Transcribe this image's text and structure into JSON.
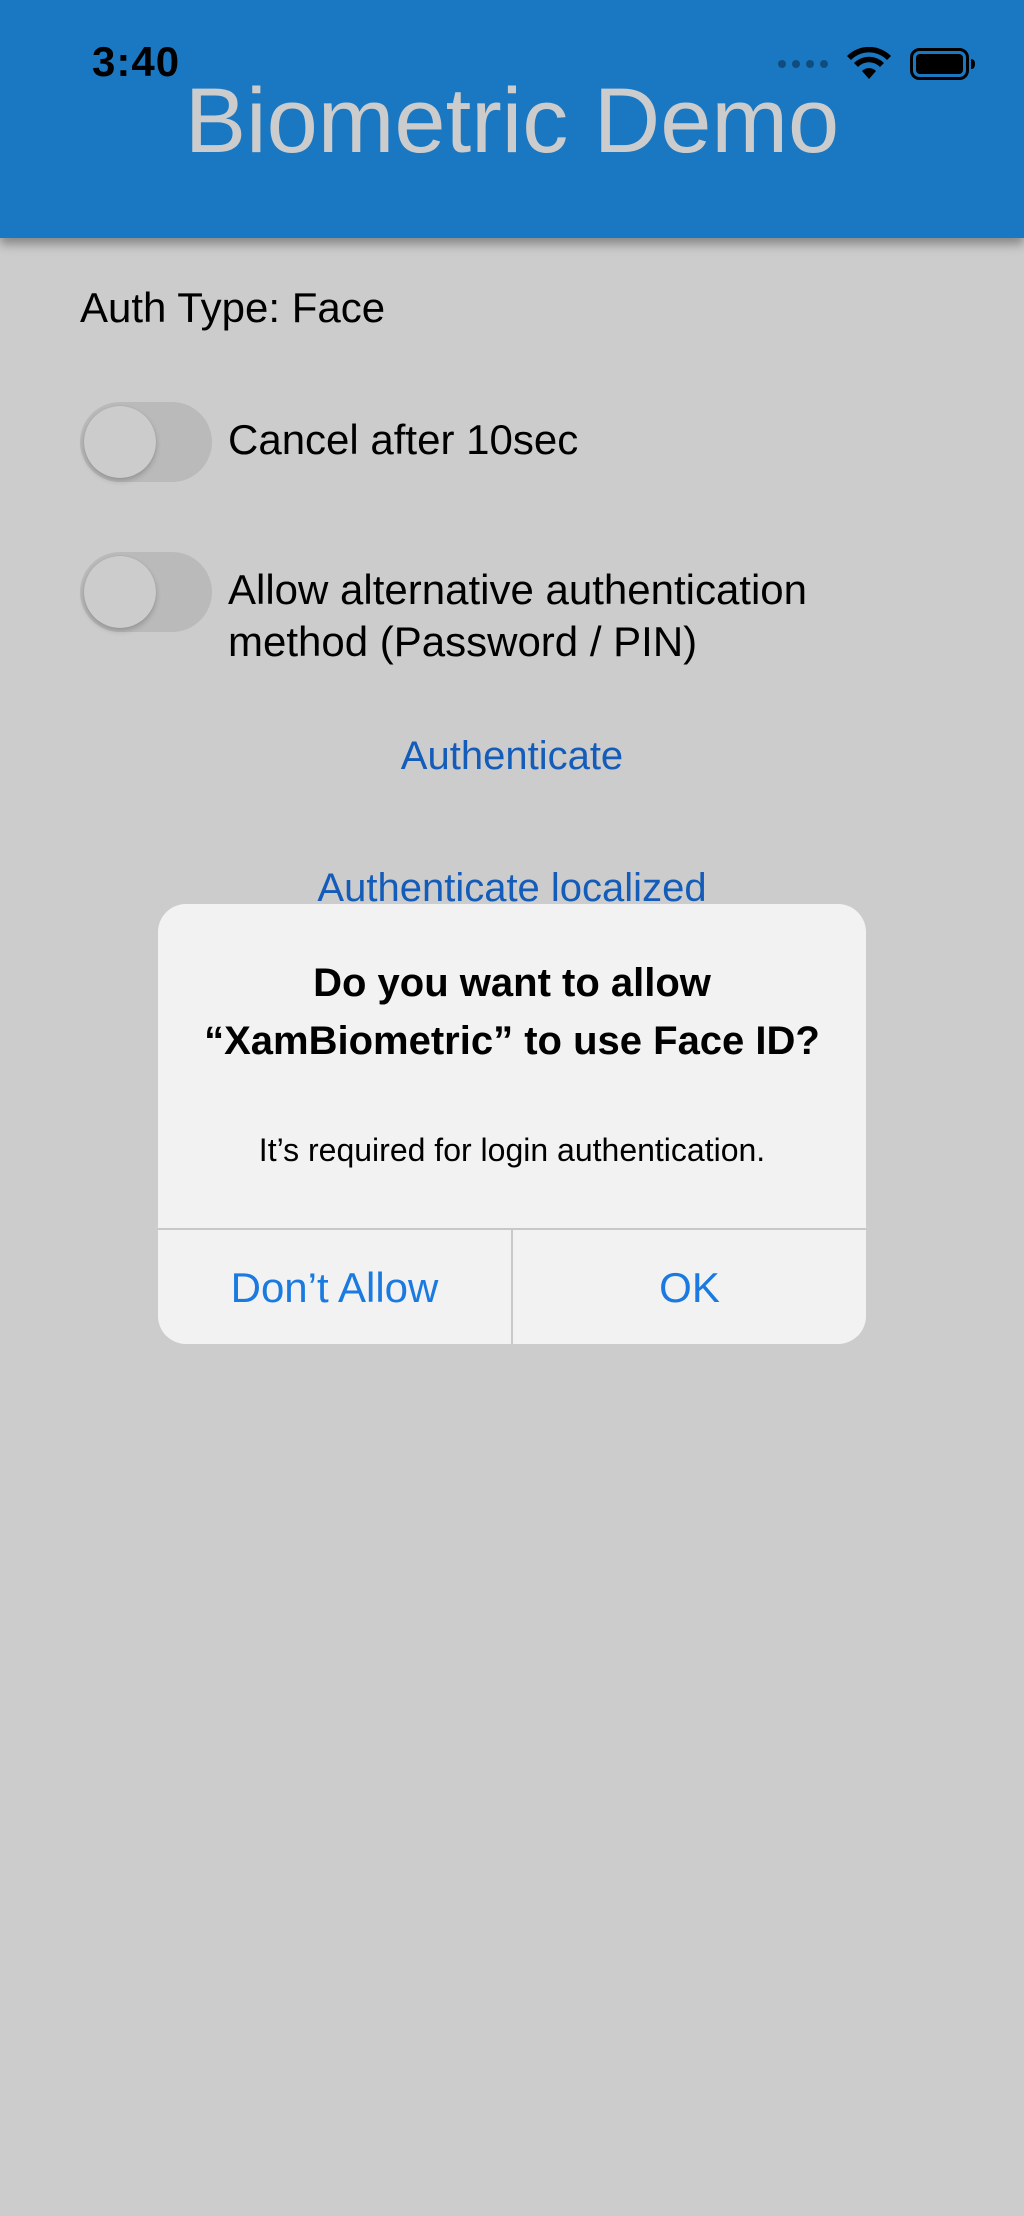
{
  "status_bar": {
    "time": "3:40",
    "signal_icon": "signal-dots-icon",
    "wifi_icon": "wifi-icon",
    "battery_icon": "battery-icon"
  },
  "navbar": {
    "title": "Biometric Demo",
    "color": "#2196f3"
  },
  "main": {
    "auth_type_label": "Auth Type: Face",
    "switches": [
      {
        "label": "Cancel after 10sec",
        "on": false
      },
      {
        "label": "Allow alternative authentication method (Password / PIN)",
        "on": false
      }
    ],
    "authenticate_label": "Authenticate",
    "authenticate_localized_label": "Authenticate localized"
  },
  "alert": {
    "title": "Do you want to allow “XamBiometric” to use Face ID?",
    "message": "It’s required for login authentication.",
    "dont_allow_label": "Don’t Allow",
    "ok_label": "OK"
  }
}
